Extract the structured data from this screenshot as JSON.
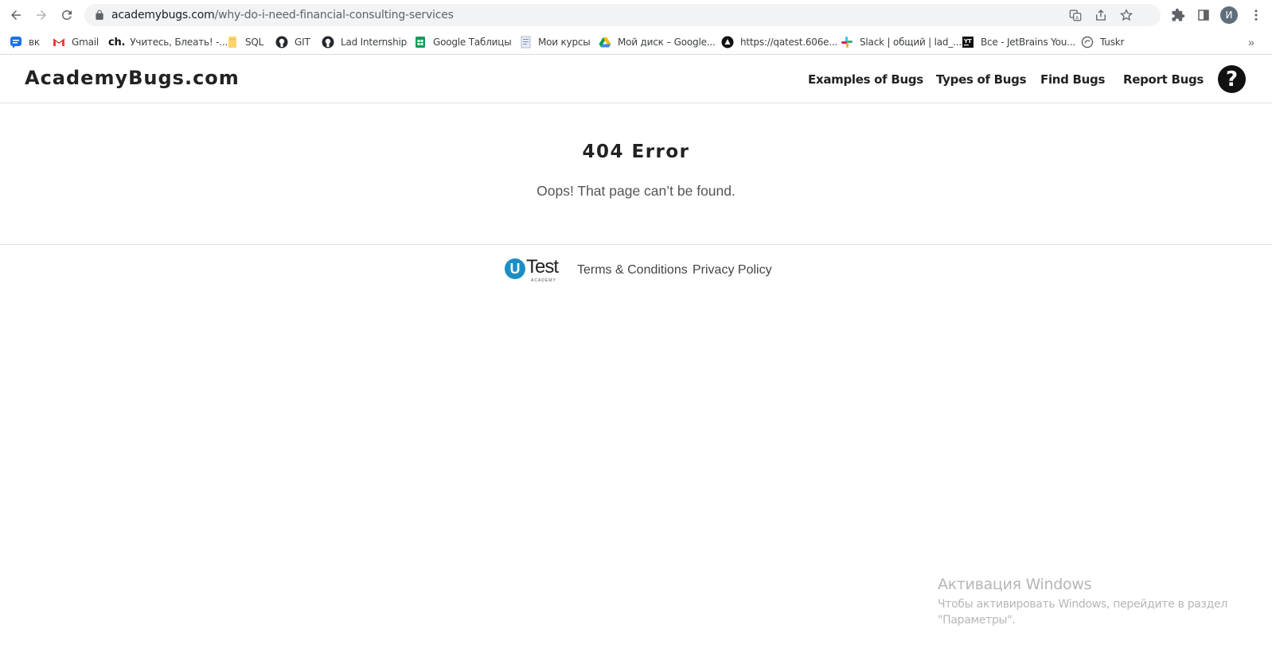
{
  "browser": {
    "url_host": "academybugs.com",
    "url_path": "/why-do-i-need-financial-consulting-services",
    "profile_initial": "И",
    "bookmarks": [
      {
        "label": "вк",
        "icon": "vk-icon"
      },
      {
        "label": "Gmail",
        "icon": "gmail-icon"
      },
      {
        "label": "Учитесь, Блеать! -...",
        "icon": "ch-icon"
      },
      {
        "label": "SQL",
        "icon": "folder-icon"
      },
      {
        "label": "GIT",
        "icon": "github-icon"
      },
      {
        "label": "Lad Internship",
        "icon": "github-icon"
      },
      {
        "label": "Google Таблицы",
        "icon": "sheets-icon"
      },
      {
        "label": "Мои курсы",
        "icon": "document-icon"
      },
      {
        "label": "Мой диск – Google...",
        "icon": "drive-icon"
      },
      {
        "label": "https://qatest.606e...",
        "icon": "triangle-icon"
      },
      {
        "label": "Slack | общий | lad_...",
        "icon": "slack-icon"
      },
      {
        "label": "Все - JetBrains You...",
        "icon": "jetbrains-icon"
      },
      {
        "label": "Tuskr",
        "icon": "tuskr-icon"
      }
    ],
    "more_bookmarks": "»"
  },
  "site": {
    "logo": "AcademyBugs.com",
    "nav": [
      "Examples of Bugs",
      "Types of Bugs",
      "Find Bugs",
      "Report Bugs"
    ],
    "help_glyph": "?"
  },
  "main": {
    "title": "404 Error",
    "message": "Oops! That page can’t be found."
  },
  "footer": {
    "logo_u": "U",
    "logo_text": "Test",
    "logo_sub": "ACADEMY",
    "links": [
      "Terms & Conditions",
      "Privacy Policy"
    ]
  },
  "watermark": {
    "title": "Активация Windows",
    "text": "Чтобы активировать Windows, перейдите в раздел \"Параметры\"."
  },
  "colors": {
    "utest_blue": "#1a8fc4",
    "header_border": "#e2e2e2",
    "text_dark": "#222222"
  }
}
